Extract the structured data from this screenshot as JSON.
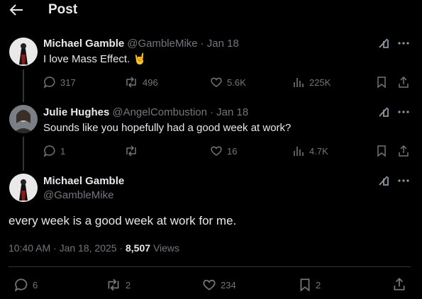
{
  "header": {
    "title": "Post"
  },
  "tweets": [
    {
      "name": "Michael Gamble",
      "handle": "@GambleMike",
      "date": "· Jan 18",
      "text": "I love Mass Effect.",
      "emoji": "🤘",
      "replies": "317",
      "reposts": "496",
      "likes": "5.6K",
      "views": "225K"
    },
    {
      "name": "Julie Hughes",
      "handle": "@AngelCombustion",
      "date": "· Jan 18",
      "text": "Sounds like you hopefully had a good week at work?",
      "replies": "1",
      "reposts": "",
      "likes": "16",
      "views": "4.7K"
    }
  ],
  "main": {
    "name": "Michael Gamble",
    "handle": "@GambleMike",
    "text": "every week is a good week at work for me.",
    "timestamp": "10:40 AM · Jan 18, 2025 ·",
    "views_count": "8,507",
    "views_label": "Views",
    "replies": "6",
    "reposts": "2",
    "likes": "234",
    "bookmarks": "2"
  },
  "icons": {
    "back": "arrow-left-icon",
    "grok": "grok-icon",
    "more": "more-icon",
    "reply": "reply-icon",
    "repost": "repost-icon",
    "like": "heart-icon",
    "views": "views-icon",
    "bookmark": "bookmark-icon",
    "share": "share-icon"
  },
  "colors": {
    "background": "#000000",
    "text": "#e7e9ea",
    "muted": "#71767b",
    "divider": "#2f3336"
  }
}
